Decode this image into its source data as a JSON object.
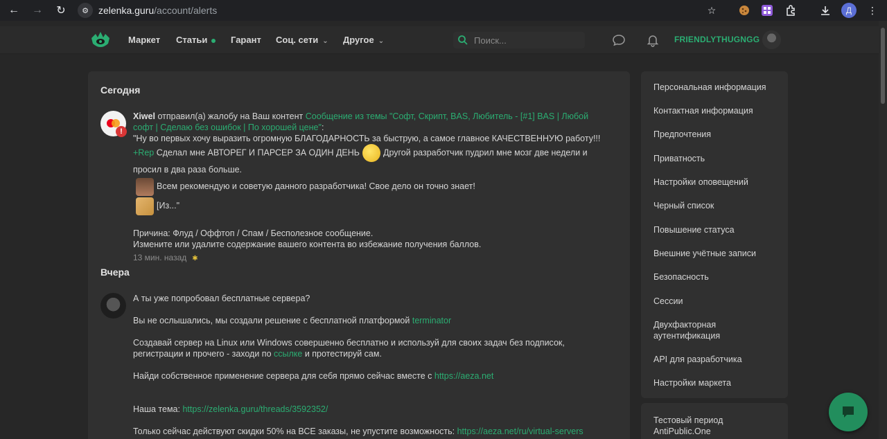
{
  "browser": {
    "url_host": "zelenka.guru",
    "url_path": "/account/alerts",
    "profile_initial": "Д"
  },
  "header": {
    "nav": [
      {
        "label": "Маркет"
      },
      {
        "label": "Статьи"
      },
      {
        "label": "Гарант"
      },
      {
        "label": "Соц. сети"
      },
      {
        "label": "Другое"
      }
    ],
    "search_placeholder": "Поиск...",
    "username": "FRIENDLYTHUGNGG"
  },
  "alerts": {
    "today_title": "Сегодня",
    "yesterday_title": "Вчера",
    "first": {
      "user": "Xiwel",
      "action": " отправил(а) жалобу на Ваш контент ",
      "link": "Сообщение из темы \"Софт, Скрипт, BAS, Любитель - [#1] BAS | Любой софт | Сделаю без ошибок | По хорошей цене\"",
      "colon": ":",
      "quote_start": "\"Ну во первых хочу выразить огромную БЛАГОДАРНОСТЬ за быструю, а самое главное КАЧЕСТВЕННУЮ работу!!!",
      "rep": "+Rep",
      "quote_mid1": " Сделал мне АВТОРЕГ И ПАРСЕР ЗА ОДИН ДЕНЬ",
      "quote_mid2": "Другой разработчик пудрил мне мозг две недели и просил в два раза больше.",
      "quote_mid3": "Всем рекомендую и советую данного разработчика! Свое дело он точно знает!",
      "quote_end": "[Из...\"",
      "reason": "Причина: Флуд / Оффтоп / Спам / Бесполезное сообщение.",
      "advice": "Измените или удалите содержание вашего контента во избежание получения баллов.",
      "time": "13 мин. назад"
    },
    "second": {
      "line1": "А ты уже попробовал бесплатные сервера?",
      "line2": "Вы не ослышались, мы создали решение с бесплатной платформой ",
      "line2_link": "terminator",
      "line3": "Создавай сервер на Linux или Windows совершенно бесплатно и используй для своих задач без подписок, регистрации и прочего - заходи по ",
      "line3_link": "ссылке",
      "line3_end": " и протестируй сам.",
      "line4": "Найди собственное применение сервера для себя прямо сейчас вместе с ",
      "line4_link": "https://aeza.net",
      "line5": "Наша тема: ",
      "line5_link": "https://zelenka.guru/threads/3592352/",
      "line6": "Только сейчас действуют скидки 50% на ВСЕ заказы, не упустите возможность: ",
      "line6_link": "https://aeza.net/ru/virtual-servers"
    }
  },
  "sidebar": {
    "items": [
      {
        "label": "Персональная информация"
      },
      {
        "label": "Контактная информация"
      },
      {
        "label": "Предпочтения"
      },
      {
        "label": "Приватность"
      },
      {
        "label": "Настройки оповещений"
      },
      {
        "label": "Черный список"
      },
      {
        "label": "Повышение статуса"
      },
      {
        "label": "Внешние учётные записи"
      },
      {
        "label": "Безопасность"
      },
      {
        "label": "Сессии"
      },
      {
        "label": "Двухфакторная аутентификация"
      },
      {
        "label": "API для разработчика"
      },
      {
        "label": "Настройки маркета"
      }
    ],
    "extra": "Тестовый период AntiPublic.One"
  },
  "colors": {
    "accent": "#2bad72",
    "background": "#272727",
    "panel": "#303030"
  }
}
